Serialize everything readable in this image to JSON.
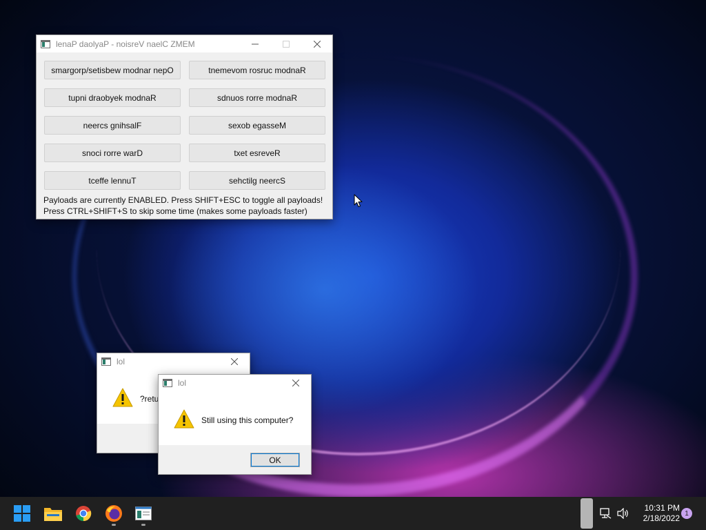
{
  "main_window": {
    "title": "lenaP daolyaP - noisreV naelC ZMEM",
    "buttons": [
      "smargorp/setisbew modnar nepO",
      "tnemevom rosruc modnaR",
      "tupni draobyek modnaR",
      "sdnuos rorre modnaR",
      "neercs gnihsalF",
      "sexob egasseM",
      "snoci rorre warD",
      "txet esreveR",
      "tceffe lennuT",
      "sehctilg neercS"
    ],
    "status_line_1": "Payloads are currently ENABLED. Press SHIFT+ESC to toggle all payloads!",
    "status_line_2": "Press CTRL+SHIFT+S to skip some time (makes some payloads faster)"
  },
  "message_back": {
    "title": "lol",
    "text": "?retu"
  },
  "message_front": {
    "title": "lol",
    "text": "Still using this computer?",
    "ok_label": "OK"
  },
  "taskbar": {
    "icons": [
      "windows-start-icon",
      "file-explorer-icon",
      "chrome-icon",
      "firefox-icon",
      "memz-app-icon"
    ],
    "time": "10:31 PM",
    "date": "2/18/2022",
    "notification_count": "1"
  },
  "colors": {
    "taskbar_bg": "#202020",
    "window_bg": "#f0f0f0",
    "button_bg": "#e6e6e6",
    "ok_focus": "#0078d7",
    "warning_yellow": "#f5c400"
  }
}
